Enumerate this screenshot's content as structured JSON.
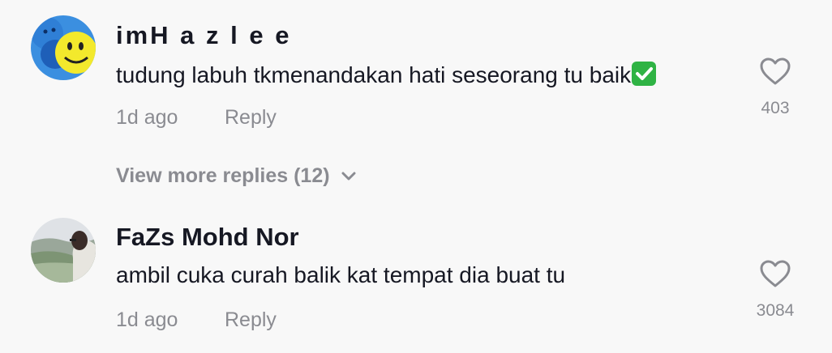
{
  "comments": [
    {
      "username": "imH a z l e e",
      "text": "tudung labuh tkmenandakan hati seseorang tu baik",
      "emoji": "check-mark-button-emoji",
      "time": "1d ago",
      "reply_label": "Reply",
      "like_count": "403",
      "more_replies": "View more replies (12)"
    },
    {
      "username": "FaZs Mohd Nor",
      "text": "ambil cuka curah balik kat tempat dia buat tu",
      "time": "1d ago",
      "reply_label": "Reply",
      "like_count": "3084"
    }
  ],
  "colors": {
    "background": "#f8f8f8",
    "primary_text": "#161823",
    "secondary_text": "#8a8b91",
    "check_green": "#2fb344"
  },
  "icons": [
    "heart-outline-icon",
    "chevron-down-icon"
  ]
}
